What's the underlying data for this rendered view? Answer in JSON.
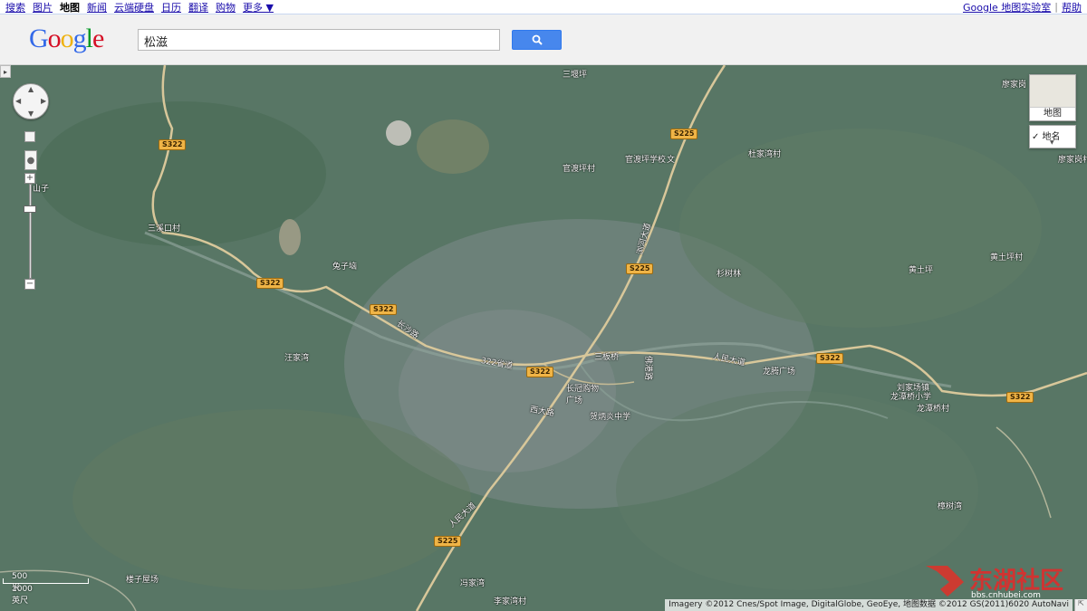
{
  "topnav": {
    "links": [
      "搜索",
      "图片",
      "地图",
      "新闻",
      "云端硬盘",
      "日历",
      "翻译",
      "购物",
      "更多 ▼"
    ],
    "active_index": 2,
    "right_links": [
      "Google 地图实验室",
      "帮助"
    ],
    "separator": "|"
  },
  "header": {
    "logo_letters": [
      "G",
      "o",
      "o",
      "g",
      "l",
      "e"
    ],
    "logo_colors": [
      "#3369e8",
      "#d50f25",
      "#eeb211",
      "#3369e8",
      "#009925",
      "#d50f25"
    ],
    "search_value": "松滋",
    "search_icon": "search-icon",
    "accent": "#4787ed"
  },
  "map": {
    "maptype_label": "地图",
    "overlay_label": "✓ 地名",
    "scale_metric": "500 米",
    "scale_imperial": "1000 英尺",
    "copyright": "Imagery ©2012 Cnes/Spot Image, DigitalGlobe, GeoEye, 地图数据 ©2012 GS(2011)6020 AutoNavi",
    "watermark_text": "东湖社区",
    "watermark_url": "bbs.cnhubei.com",
    "place_labels": [
      "三堰坪",
      "官渡坪村",
      "官渡坪学校",
      "文",
      "杜家湾村",
      "廖家岗",
      "廖家岗村",
      "三溪口村",
      "兔子垴",
      "长沙路",
      "汪家湾",
      "322省道",
      "三板桥",
      "佛港路",
      "长冠购物广场",
      "浏河大道",
      "杉树林",
      "人民大道",
      "龙腾广场",
      "刘家场镇",
      "龙潭桥小学",
      "龙潭桥村",
      "黄土坪",
      "黄土坪村",
      "西大路",
      "贺炳炎中学",
      "人民大道",
      "楼子屋场",
      "冯家湾",
      "李家湾村",
      "樟树湾",
      "山子"
    ],
    "road_shields": [
      "S322",
      "S322",
      "S322",
      "S322",
      "S322",
      "S322",
      "S225",
      "S225",
      "S225"
    ]
  }
}
